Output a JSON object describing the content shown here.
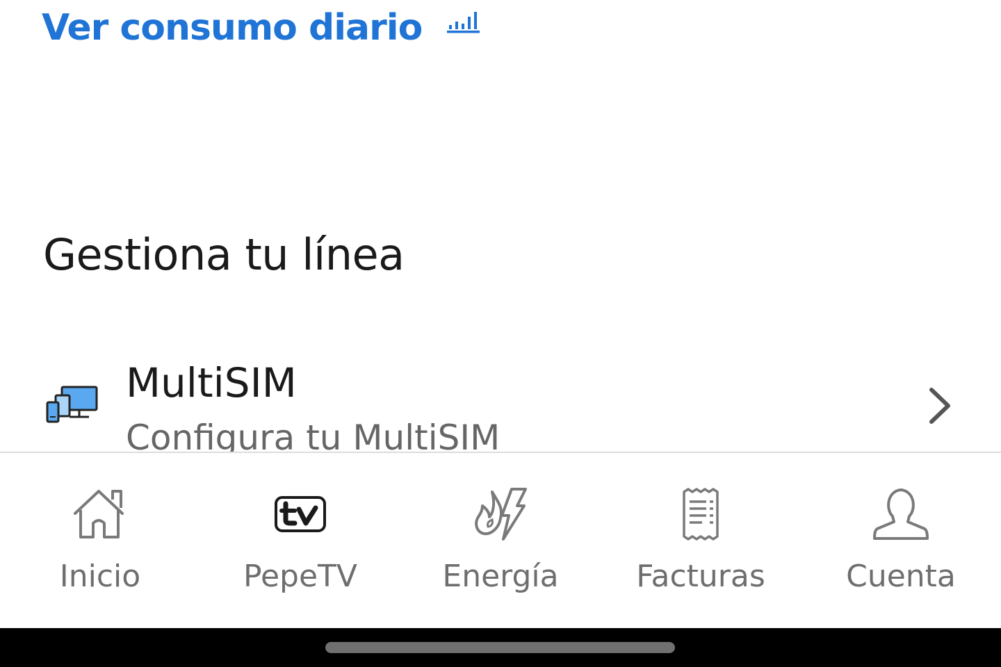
{
  "consumo": {
    "label": "Ver consumo diario",
    "icon": "bar-chart-icon",
    "color": "#1f74d6"
  },
  "section": {
    "title": "Gestiona tu línea"
  },
  "multisim": {
    "title": "MultiSIM",
    "subtitle": "Configura tu MultiSIM",
    "icon": "multi-device-icon"
  },
  "nav": {
    "items": [
      {
        "label": "Inicio",
        "icon": "home-icon"
      },
      {
        "label": "PepeTV",
        "icon": "tv-icon"
      },
      {
        "label": "Energía",
        "icon": "energy-icon"
      },
      {
        "label": "Facturas",
        "icon": "invoice-icon"
      },
      {
        "label": "Cuenta",
        "icon": "user-icon"
      }
    ]
  }
}
